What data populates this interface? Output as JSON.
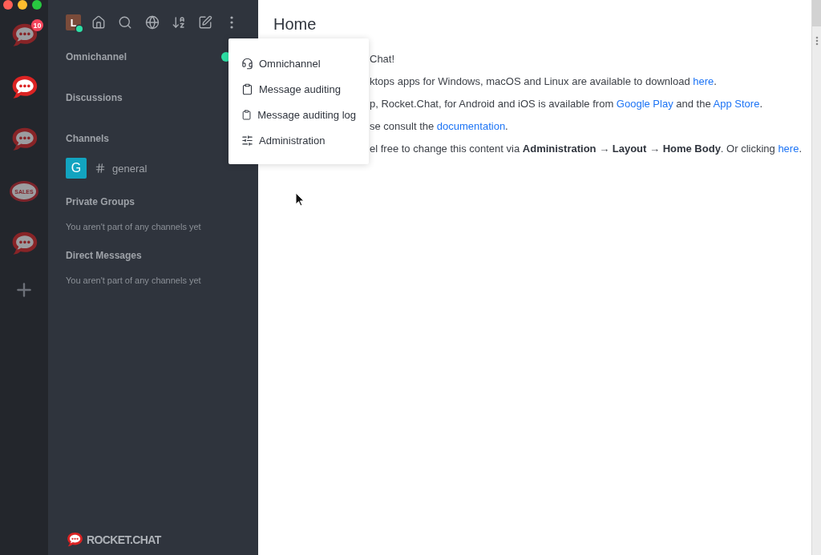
{
  "servers": [
    {
      "kind": "logo",
      "selected": false,
      "badge": "10"
    },
    {
      "kind": "logo",
      "selected": true
    },
    {
      "kind": "logo",
      "selected": false
    },
    {
      "kind": "label",
      "label": "SALES",
      "selected": false
    },
    {
      "kind": "logo",
      "selected": false
    }
  ],
  "sidebar": {
    "user": {
      "initial": "L",
      "online": true
    },
    "sections": [
      {
        "kind": "toggle",
        "title": "Omnichannel",
        "available": true
      },
      {
        "kind": "plain",
        "title": "Discussions"
      },
      {
        "kind": "rooms",
        "title": "Channels",
        "rooms": [
          {
            "initial": "G",
            "name": "general",
            "color": "#12a4c0"
          }
        ]
      },
      {
        "kind": "empty",
        "title": "Private Groups",
        "empty_text": "You aren't part of any channels yet"
      },
      {
        "kind": "empty",
        "title": "Direct Messages",
        "empty_text": "You aren't part of any channels yet"
      }
    ],
    "footer_logo": "ROCKET.CHAT"
  },
  "menu": {
    "items": [
      {
        "kind": "service",
        "label": "Omnichannel"
      },
      {
        "kind": "audit",
        "label": "Message auditing"
      },
      {
        "kind": "audit",
        "label": "Message auditing log"
      },
      {
        "kind": "admin",
        "label": "Administration"
      }
    ]
  },
  "main": {
    "title": "Home",
    "paragraphs": [
      {
        "parts": [
          {
            "kind": "text",
            "text": "Chat!"
          }
        ]
      },
      {
        "parts": [
          {
            "kind": "text",
            "text": "ktops apps for Windows, macOS and Linux are available to download "
          },
          {
            "kind": "link",
            "text": "here"
          },
          {
            "kind": "text",
            "text": "."
          }
        ]
      },
      {
        "parts": [
          {
            "kind": "text",
            "text": "p, Rocket.Chat, for Android and iOS is available from "
          },
          {
            "kind": "link",
            "text": "Google Play"
          },
          {
            "kind": "text",
            "text": " and the "
          },
          {
            "kind": "link",
            "text": "App Store"
          },
          {
            "kind": "text",
            "text": "."
          }
        ]
      },
      {
        "parts": [
          {
            "kind": "text",
            "text": "se consult the "
          },
          {
            "kind": "link",
            "text": "documentation"
          },
          {
            "kind": "text",
            "text": "."
          }
        ]
      },
      {
        "parts": [
          {
            "kind": "text",
            "text": "el free to change this content via **Administration** → **Layout** → **Home Body**. Or clicking "
          },
          {
            "kind": "link",
            "text": "here"
          },
          {
            "kind": "text",
            "text": "."
          }
        ]
      }
    ]
  }
}
